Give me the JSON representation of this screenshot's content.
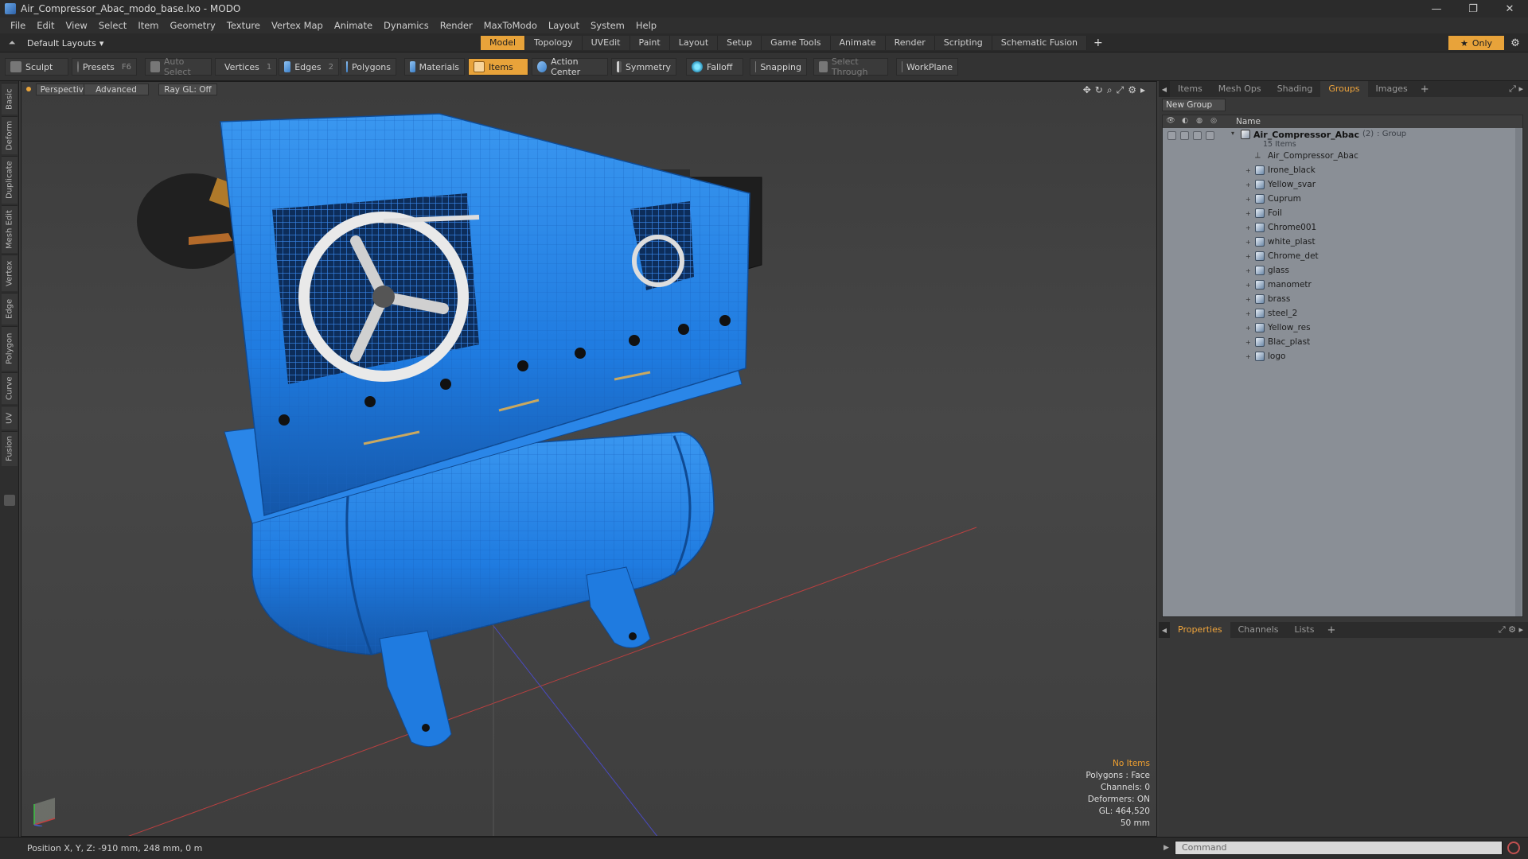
{
  "window": {
    "title": "Air_Compressor_Abac_modo_base.lxo - MODO",
    "controls": {
      "minimize": "—",
      "restore": "❐",
      "close": "✕"
    }
  },
  "menu": [
    "File",
    "Edit",
    "View",
    "Select",
    "Item",
    "Geometry",
    "Texture",
    "Vertex Map",
    "Animate",
    "Dynamics",
    "Render",
    "MaxToModo",
    "Layout",
    "System",
    "Help"
  ],
  "layout_bar": {
    "layout_label": "Default Layouts",
    "tabs": [
      "Model",
      "Topology",
      "UVEdit",
      "Paint",
      "Layout",
      "Setup",
      "Game Tools",
      "Animate",
      "Render",
      "Scripting",
      "Schematic Fusion"
    ],
    "active_tab": "Model",
    "plus": "+",
    "only_label": "Only"
  },
  "toolbar": {
    "sculpt": "Sculpt",
    "presets": "Presets",
    "presets_key": "F6",
    "auto_select": "Auto Select",
    "vertices": "Vertices",
    "vertices_key": "1",
    "edges": "Edges",
    "edges_key": "2",
    "polygons": "Polygons",
    "materials": "Materials",
    "items": "Items",
    "action_center": "Action Center",
    "symmetry": "Symmetry",
    "falloff": "Falloff",
    "snapping": "Snapping",
    "select_through": "Select Through",
    "workplane": "WorkPlane"
  },
  "left_tabs": [
    "Basic",
    "Deform",
    "Duplicate",
    "Mesh Edit",
    "Vertex",
    "Edge",
    "Polygon",
    "Curve",
    "UV",
    "Fusion"
  ],
  "viewport": {
    "view": "Perspective",
    "shading": "Advanced",
    "raygl": "Ray GL: Off",
    "info": {
      "no_items": "No Items",
      "polygons": "Polygons : Face",
      "channels": "Channels: 0",
      "deformers": "Deformers: ON",
      "gl": "GL: 464,520",
      "scale": "50 mm"
    },
    "colors": {
      "model": "#1f7be0",
      "model_dark": "#1560b8",
      "background": "#444444"
    }
  },
  "right_panel": {
    "tabs": [
      "Items",
      "Mesh Ops",
      "Shading",
      "Groups",
      "Images"
    ],
    "active_tab": "Groups",
    "plus": "+",
    "new_group": "New Group",
    "column_name": "Name",
    "group": {
      "name": "Air_Compressor_Abac",
      "count": "(2)",
      "type": ": Group",
      "sub": "15 Items"
    },
    "items": [
      "Air_Compressor_Abac",
      "Irone_black",
      "Yellow_svar",
      "Cuprum",
      "Foil",
      "Chrome001",
      "white_plast",
      "Chrome_det",
      "glass",
      "manometr",
      "brass",
      "steel_2",
      "Yellow_res",
      "Blac_plast",
      "logo"
    ]
  },
  "bottom_panel": {
    "tabs": [
      "Properties",
      "Channels",
      "Lists"
    ],
    "active_tab": "Properties",
    "plus": "+"
  },
  "status": {
    "position": "Position X, Y, Z:  -910 mm, 248 mm, 0 m",
    "command_placeholder": "Command"
  },
  "accent_color": "#e8a33a"
}
